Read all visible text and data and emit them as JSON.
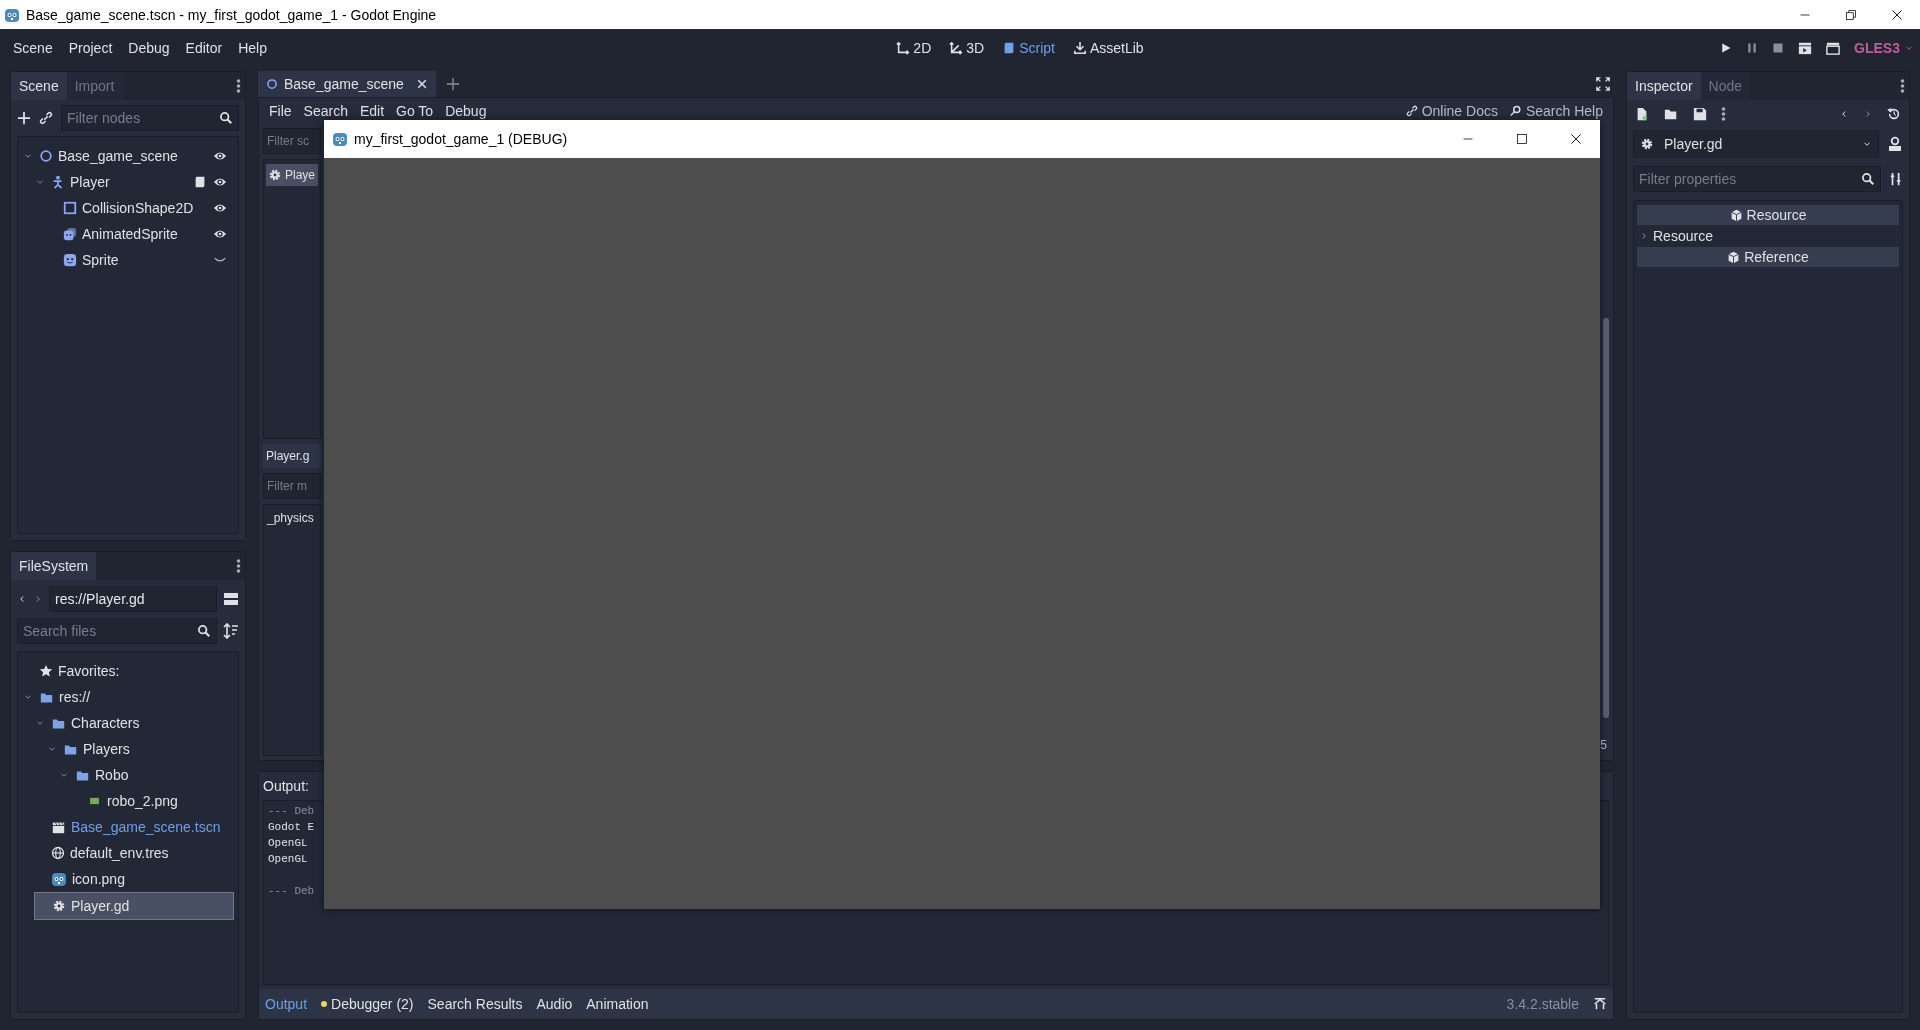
{
  "window": {
    "title": "Base_game_scene.tscn - my_first_godot_game_1 - Godot Engine"
  },
  "menu": [
    "Scene",
    "Project",
    "Debug",
    "Editor",
    "Help"
  ],
  "workspaces": [
    {
      "label": "2D",
      "kind": "planar",
      "selected": false
    },
    {
      "label": "3D",
      "kind": "spatial",
      "selected": false
    },
    {
      "label": "Script",
      "kind": "script",
      "selected": true
    },
    {
      "label": "AssetLib",
      "kind": "assetlib",
      "selected": false
    }
  ],
  "renderer": "GLES3",
  "scene_dock": {
    "tabs": [
      {
        "label": "Scene",
        "selected": true
      },
      {
        "label": "Import",
        "selected": false
      }
    ],
    "filter": {
      "placeholder": "Filter nodes"
    },
    "tree": [
      {
        "name": "Base_game_scene",
        "kind": "node",
        "visible": true,
        "has_script": false,
        "expanded": true,
        "children": [
          {
            "name": "Player",
            "kind": "kinematic",
            "visible": true,
            "has_script": true,
            "expanded": true,
            "children": [
              {
                "name": "CollisionShape2D",
                "kind": "shape",
                "visible": true,
                "has_script": false
              },
              {
                "name": "AnimatedSprite",
                "kind": "animated",
                "visible": true,
                "has_script": false
              },
              {
                "name": "Sprite",
                "kind": "sprite",
                "visible": false,
                "has_script": false
              }
            ]
          }
        ]
      }
    ]
  },
  "filesystem": {
    "tabs": [
      {
        "label": "FileSystem",
        "selected": true
      }
    ],
    "path": "res://Player.gd",
    "search": {
      "placeholder": "Search files"
    },
    "tree": [
      {
        "name": "Favorites:",
        "kind": "favorites",
        "selected": false,
        "current": false
      },
      {
        "name": "res://",
        "kind": "folder",
        "expanded": true,
        "selected": false,
        "current": false,
        "children": [
          {
            "name": "Characters",
            "kind": "folder",
            "expanded": true,
            "selected": false,
            "current": false,
            "children": [
              {
                "name": "Players",
                "kind": "folder",
                "expanded": true,
                "selected": false,
                "current": false,
                "children": [
                  {
                    "name": "Robo",
                    "kind": "folder",
                    "expanded": true,
                    "selected": false,
                    "current": false,
                    "children": [
                      {
                        "name": "robo_2.png",
                        "kind": "image",
                        "selected": false,
                        "current": false
                      }
                    ]
                  }
                ]
              }
            ]
          },
          {
            "name": "Base_game_scene.tscn",
            "kind": "scene",
            "selected": false,
            "current": true
          },
          {
            "name": "default_env.tres",
            "kind": "environment",
            "selected": false,
            "current": false
          },
          {
            "name": "icon.png",
            "kind": "robot-image",
            "selected": false,
            "current": false
          },
          {
            "name": "Player.gd",
            "kind": "script",
            "selected": true,
            "current": false
          }
        ]
      }
    ]
  },
  "script_editor": {
    "tabs": [
      {
        "label": "Base_game_scene",
        "selected": true
      }
    ],
    "menu": [
      "File",
      "Search",
      "Edit",
      "Go To",
      "Debug"
    ],
    "help_links": [
      {
        "label": "Online Docs",
        "kind": "docs"
      },
      {
        "label": "Search Help",
        "kind": "help"
      }
    ],
    "script_filter": {
      "placeholder": "Filter sc"
    },
    "scripts": [
      {
        "name": "Playe",
        "selected": true
      }
    ],
    "current_script": "Player.g",
    "method_filter": {
      "placeholder": "Filter m"
    },
    "methods": [
      "_physics"
    ],
    "line_info": "5"
  },
  "output": {
    "title": "Output:",
    "lines": [
      {
        "text": "--- Deb",
        "kind": "header"
      },
      {
        "text": "Godot E",
        "kind": "info"
      },
      {
        "text": "OpenGL",
        "kind": "info"
      },
      {
        "text": "OpenGL",
        "kind": "info"
      },
      {
        "text": "--- Deb",
        "kind": "header"
      }
    ]
  },
  "bottom_tabs": [
    {
      "label": "Output",
      "selected": true,
      "alert": false
    },
    {
      "label": "Debugger (2)",
      "selected": false,
      "alert": true
    },
    {
      "label": "Search Results",
      "selected": false,
      "alert": false
    },
    {
      "label": "Audio",
      "selected": false,
      "alert": false
    },
    {
      "label": "Animation",
      "selected": false,
      "alert": false
    }
  ],
  "version": "3.4.2.stable",
  "inspector": {
    "tabs": [
      {
        "label": "Inspector",
        "selected": true
      },
      {
        "label": "Node",
        "selected": false
      }
    ],
    "object": "Player.gd",
    "filter": {
      "placeholder": "Filter properties"
    },
    "sections": [
      {
        "label": "Resource",
        "kind": "category"
      },
      {
        "label": "Resource",
        "kind": "group",
        "expanded": false
      },
      {
        "label": "Reference",
        "kind": "category"
      }
    ]
  },
  "debug_window": {
    "title": "my_first_godot_game_1 (DEBUG)"
  }
}
